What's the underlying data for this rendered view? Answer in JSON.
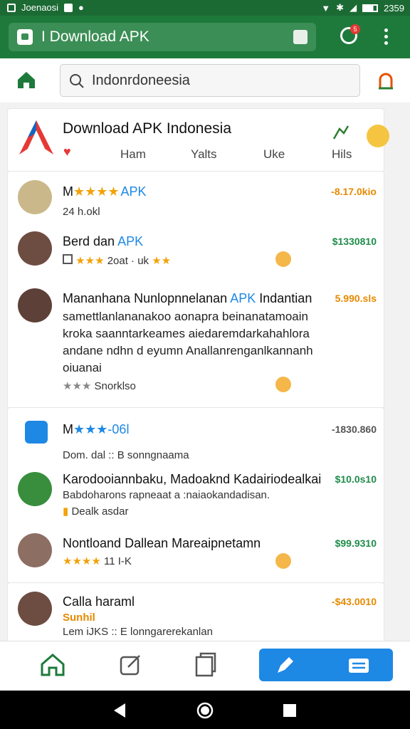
{
  "status_bar": {
    "left_text": "Joenaosi",
    "time": "2359"
  },
  "toolbar": {
    "url": "I Download APK",
    "tab_count": "5"
  },
  "search": {
    "value": "Indonrdoneesia"
  },
  "header_card": {
    "title": "Download APK Indonesia",
    "tabs": [
      "Ham",
      "Yalts",
      "Uke",
      "Hils"
    ]
  },
  "list1": [
    {
      "title_prefix": "M",
      "title_suffix": "APK",
      "stars": "★★★★",
      "sub": "24 h.okl",
      "price": "-8.17.0kio"
    },
    {
      "title": "Berd dan",
      "title_suffix": "APK",
      "stars": "★★★",
      "meta": "2oat · uk",
      "meta_stars": "★★",
      "price": "$1330810"
    },
    {
      "title": "Mananhana Nunlopnnelanan",
      "title_suffix": "APK",
      "title_tail": "Indantian",
      "body": [
        "samettlanlananakoo aonapra beinanatamoain",
        "kroka saanntarkeames aiedaremdarkahahlora",
        "andane ndhn d eyumn Anallanrenganlkannanh",
        "oiuanai"
      ],
      "stars": "★★★",
      "meta": "Snorklso",
      "price": "5.990.sls"
    }
  ],
  "list2": [
    {
      "title_prefix": "M",
      "stars": "★★★",
      "title_suffix": "-06l",
      "sub": "Dom. dal :: B sonngnaama",
      "price": "-1830.860"
    },
    {
      "title": "Karodooiannbaku, Madoaknd Kadairiodealkai",
      "sub": "Babdoharons rapneaat a :naiaokandadisan.",
      "meta": "Dealk asdar",
      "price": "$10.0s10"
    },
    {
      "title": "Nontloand Dallean Mareaipnetamn",
      "stars": "★★★★",
      "meta": "11 I-K",
      "price": "$99.9310"
    }
  ],
  "list3": [
    {
      "title": "Calla haraml",
      "sub1": "Sunhil",
      "sub2": "Lem iJKS :: E lonngarerekanlan",
      "price": "-$43.0010"
    }
  ],
  "colors": {
    "primary": "#1e7a3b",
    "accent_blue": "#1e88e5",
    "price_orange": "#e68a00",
    "price_green": "#1e8c4a"
  }
}
